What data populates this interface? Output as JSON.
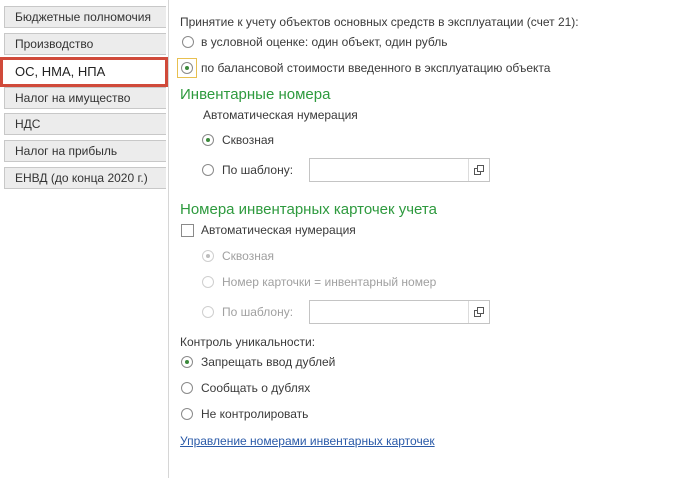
{
  "sidebar": {
    "items": [
      {
        "label": "Бюджетные полномочия",
        "active": false
      },
      {
        "label": "Производство",
        "active": false
      },
      {
        "label": "ОС, НМА, НПА",
        "active": true
      },
      {
        "label": "Налог на имущество",
        "active": false
      },
      {
        "label": "НДС",
        "active": false
      },
      {
        "label": "Налог на прибыль",
        "active": false
      },
      {
        "label": "ЕНВД (до конца 2020 г.)",
        "active": false
      }
    ]
  },
  "acceptance": {
    "title": "Принятие к учету объектов основных средств в эксплуатации (счет 21):",
    "options": [
      {
        "label": "в условной оценке: один объект, один рубль",
        "selected": false
      },
      {
        "label": "по балансовой стоимости введенного в эксплуатацию объекта",
        "selected": true
      }
    ]
  },
  "inventory_numbers": {
    "heading": "Инвентарные номера",
    "auto_label": "Автоматическая нумерация",
    "options": [
      {
        "label": "Сквозная",
        "selected": true
      },
      {
        "label": "По шаблону:",
        "selected": false
      }
    ],
    "template_value": ""
  },
  "card_numbers": {
    "heading": "Номера инвентарных карточек учета",
    "auto_checkbox_label": "Автоматическая нумерация",
    "auto_checked": false,
    "options": [
      {
        "label": "Сквозная",
        "selected": true
      },
      {
        "label": "Номер карточки = инвентарный номер",
        "selected": false
      },
      {
        "label": "По шаблону:",
        "selected": false
      }
    ],
    "template_value": ""
  },
  "uniqueness": {
    "title": "Контроль уникальности:",
    "options": [
      {
        "label": "Запрещать ввод дублей",
        "selected": true
      },
      {
        "label": "Сообщать о дублях",
        "selected": false
      },
      {
        "label": "Не контролировать",
        "selected": false
      }
    ]
  },
  "manage_link": "Управление номерами инвентарных карточек",
  "colors": {
    "accent_green": "#2e9a3e",
    "active_tab_border": "#d04a3a",
    "link": "#2a5aa8"
  }
}
